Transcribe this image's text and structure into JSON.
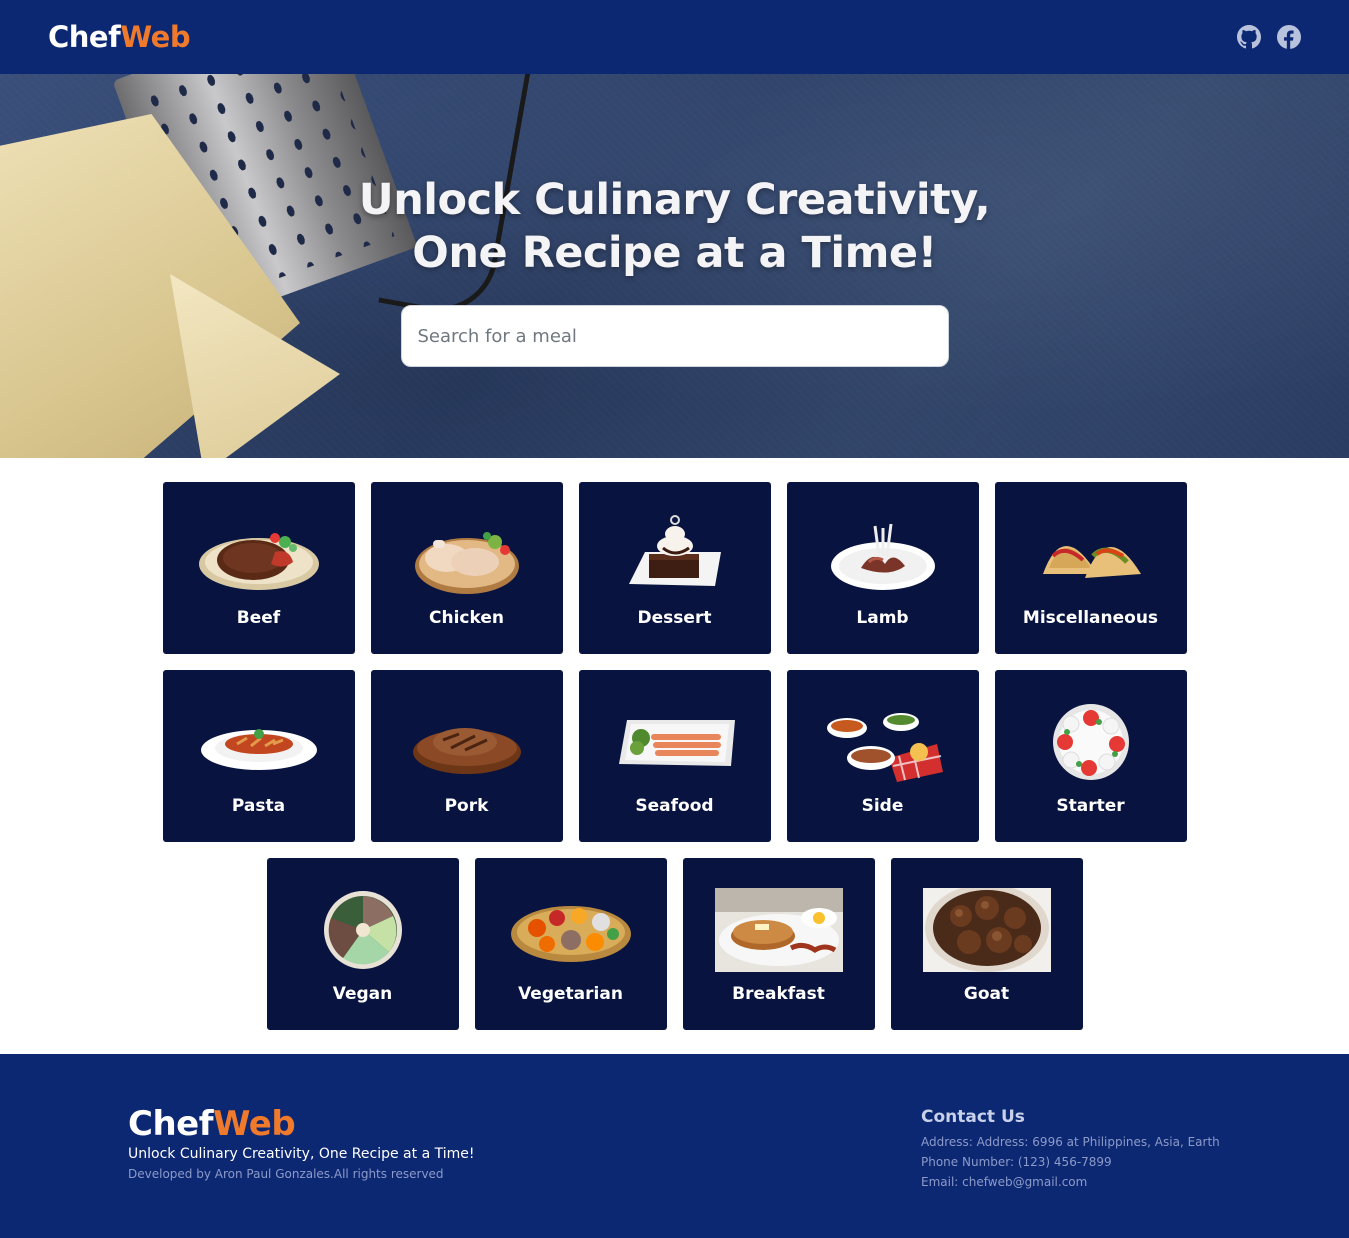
{
  "header": {
    "logo_part1": "Chef",
    "logo_part2": "Web",
    "social_icons": [
      "github-icon",
      "facebook-icon"
    ]
  },
  "hero": {
    "title_line1": "Unlock Culinary Creativity,",
    "title_line2": "One Recipe at a Time!",
    "search_placeholder": "Search for a meal"
  },
  "categories": [
    {
      "label": "Beef",
      "icon": "steak-plate"
    },
    {
      "label": "Chicken",
      "icon": "chicken-legs"
    },
    {
      "label": "Dessert",
      "icon": "chocolate-cake"
    },
    {
      "label": "Lamb",
      "icon": "lamb-chops"
    },
    {
      "label": "Miscellaneous",
      "icon": "tacos"
    },
    {
      "label": "Pasta",
      "icon": "pasta-plate"
    },
    {
      "label": "Pork",
      "icon": "pork-steak"
    },
    {
      "label": "Seafood",
      "icon": "salmon-platter"
    },
    {
      "label": "Side",
      "icon": "side-bowls"
    },
    {
      "label": "Starter",
      "icon": "caprese-plate"
    },
    {
      "label": "Vegan",
      "icon": "vegan-bowl"
    },
    {
      "label": "Vegetarian",
      "icon": "vegetarian-platter"
    },
    {
      "label": "Breakfast",
      "icon": "pancakes-photo"
    },
    {
      "label": "Goat",
      "icon": "goat-meat-photo"
    }
  ],
  "footer": {
    "logo_part1": "Chef",
    "logo_part2": "Web",
    "tagline": "Unlock Culinary Creativity, One Recipe at a Time!",
    "credit": "Developed by Aron Paul Gonzales.All rights reserved",
    "contact_heading": "Contact Us",
    "address": "Address: Address: 6996 at Philippines, Asia, Earth",
    "phone": "Phone Number: (123) 456-7899",
    "email": "Email: chefweb@gmail.com"
  },
  "colors": {
    "brand_navy": "#0d2872",
    "card_navy": "#08143f",
    "accent_orange": "#f07a2c"
  }
}
